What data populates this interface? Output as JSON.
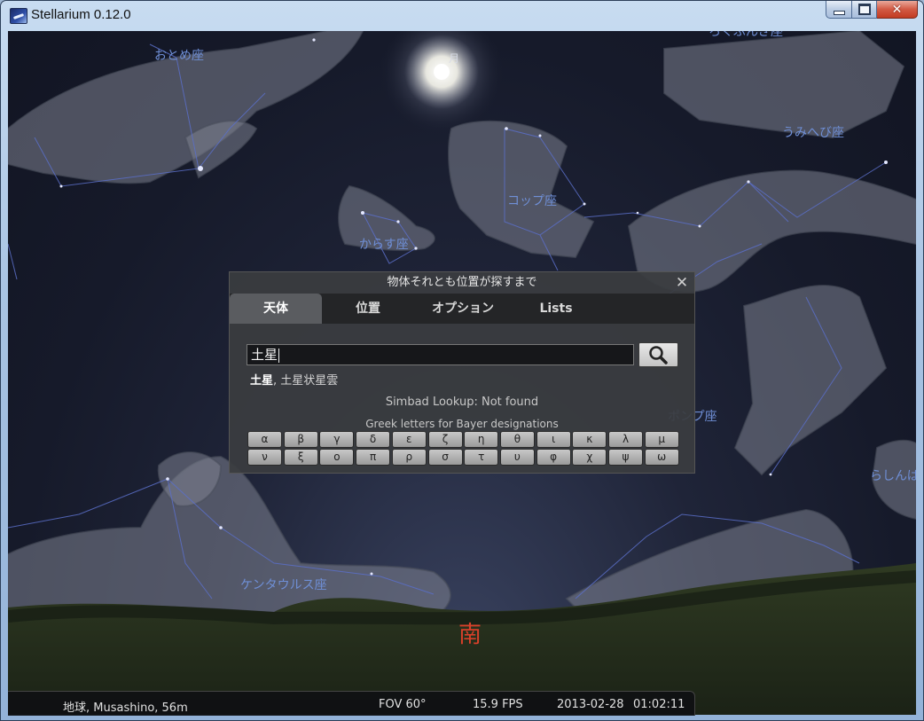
{
  "window": {
    "title": "Stellarium 0.12.0"
  },
  "sky": {
    "constellations": [
      {
        "label": "おとめ座"
      },
      {
        "label": "コップ座"
      },
      {
        "label": "からす座"
      },
      {
        "label": "うみへび座"
      },
      {
        "label": "ポンプ座"
      },
      {
        "label": "らしんばん座"
      },
      {
        "label": "ケンタウルス座"
      },
      {
        "label": "ろくぶんぎ座"
      }
    ],
    "moon_label": "月",
    "cardinal": "南"
  },
  "dialog": {
    "title": "物体それとも位置が探すまで",
    "tabs": [
      {
        "label": "天体",
        "active": true
      },
      {
        "label": "位置",
        "active": false
      },
      {
        "label": "オプション",
        "active": false
      },
      {
        "label": "Lists",
        "active": false
      }
    ],
    "search": {
      "value": "土星",
      "icon": "search-icon"
    },
    "results": {
      "first": "土星",
      "rest": ", 土星状星雲"
    },
    "simbad": "Simbad Lookup: Not found",
    "greek_title": "Greek letters for Bayer designations",
    "greek_letters": [
      "α",
      "β",
      "γ",
      "δ",
      "ε",
      "ζ",
      "η",
      "θ",
      "ι",
      "κ",
      "λ",
      "μ",
      "ν",
      "ξ",
      "ο",
      "π",
      "ρ",
      "σ",
      "τ",
      "υ",
      "φ",
      "χ",
      "ψ",
      "ω"
    ]
  },
  "statusbar": {
    "location": "地球, Musashino, 56m",
    "fov": "FOV 60°",
    "fps": "15.9 FPS",
    "date": "2013-02-28",
    "time": "01:02:11"
  },
  "colors": {
    "constellation_label": "#6f8fd6",
    "cardinal": "#d8402a",
    "sky": "#161a2a"
  }
}
